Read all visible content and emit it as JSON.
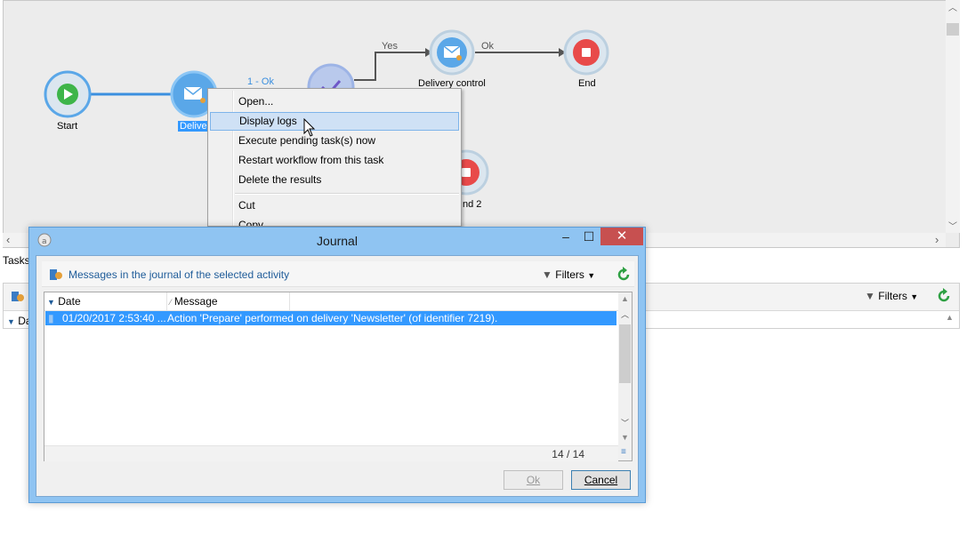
{
  "workflow": {
    "nodes": {
      "start": "Start",
      "delivery": "Deliver",
      "delivery_control": "Delivery control",
      "end": "End",
      "end2": "nd 2"
    },
    "transitions": {
      "ok_1": "1 - Ok",
      "yes": "Yes",
      "ok": "Ok"
    }
  },
  "context_menu": {
    "items": [
      "Open...",
      "Display logs",
      "Execute pending task(s) now",
      "Restart workflow from this task",
      "Delete the results",
      "Cut",
      "Copy"
    ]
  },
  "lower_panel": {
    "tab": "Tasks",
    "filters_label": "Filters",
    "column_partial": "Da"
  },
  "journal": {
    "title": "Journal",
    "toolbar_title": "Messages in the journal of the selected activity",
    "filters_label": "Filters",
    "columns": [
      "Date",
      "Message"
    ],
    "rows": [
      {
        "date": "01/20/2017 2:53:40 ...",
        "message": "Action 'Prepare' performed on delivery 'Newsletter' (of identifier 7219)."
      }
    ],
    "row_count": "14 / 14",
    "ok_label": "Ok",
    "cancel_label": "Cancel"
  },
  "colors": {
    "node_blue": "#5aa7e8",
    "start_green": "#3db54a",
    "end_red": "#e84a4a",
    "selection_blue": "#3399ff",
    "refresh_green": "#2ea043"
  }
}
